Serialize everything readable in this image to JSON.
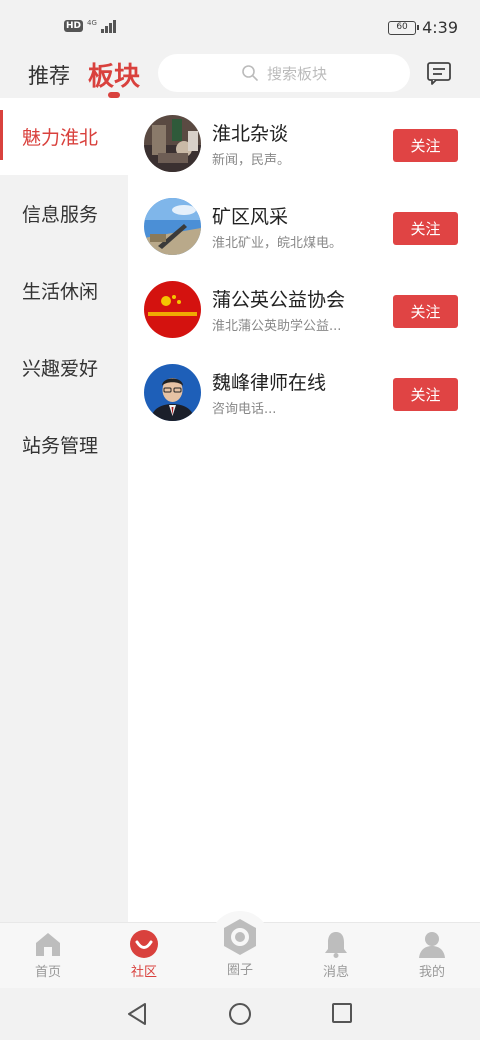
{
  "status_bar": {
    "hd": "HD",
    "network": "4G",
    "battery": "60",
    "time": "4:39"
  },
  "header": {
    "tabs": [
      {
        "label": "推荐"
      },
      {
        "label": "板块"
      }
    ],
    "search_placeholder": "搜索板块",
    "icons": {
      "search": "search-icon",
      "message": "message-icon"
    }
  },
  "sidebar": {
    "items": [
      {
        "label": "魅力淮北",
        "active": true
      },
      {
        "label": "信息服务"
      },
      {
        "label": "生活休闲"
      },
      {
        "label": "兴趣爱好"
      },
      {
        "label": "站务管理"
      }
    ]
  },
  "boards": [
    {
      "title": "淮北杂谈",
      "subtitle": "新闻，民声。",
      "follow": "关注",
      "avatar": "street-photo-avatar"
    },
    {
      "title": "矿区风采",
      "subtitle": "淮北矿业，皖北煤电。",
      "follow": "关注",
      "avatar": "mine-photo-avatar"
    },
    {
      "title": "蒲公英公益协会",
      "subtitle": "淮北蒲公英助学公益...",
      "follow": "关注",
      "avatar": "red-banner-avatar"
    },
    {
      "title": "魏峰律师在线",
      "subtitle": "咨询电话...",
      "follow": "关注",
      "avatar": "lawyer-portrait-avatar"
    }
  ],
  "bottom_nav": {
    "items": [
      {
        "label": "首页",
        "icon": "home-icon"
      },
      {
        "label": "社区",
        "icon": "community-icon",
        "active": true
      },
      {
        "label": "圈子",
        "icon": "circle-icon"
      },
      {
        "label": "消息",
        "icon": "bell-icon"
      },
      {
        "label": "我的",
        "icon": "user-icon"
      }
    ]
  },
  "colors": {
    "accent": "#d9413d",
    "follow_button": "#e04444",
    "background": "#f2f2f2"
  }
}
